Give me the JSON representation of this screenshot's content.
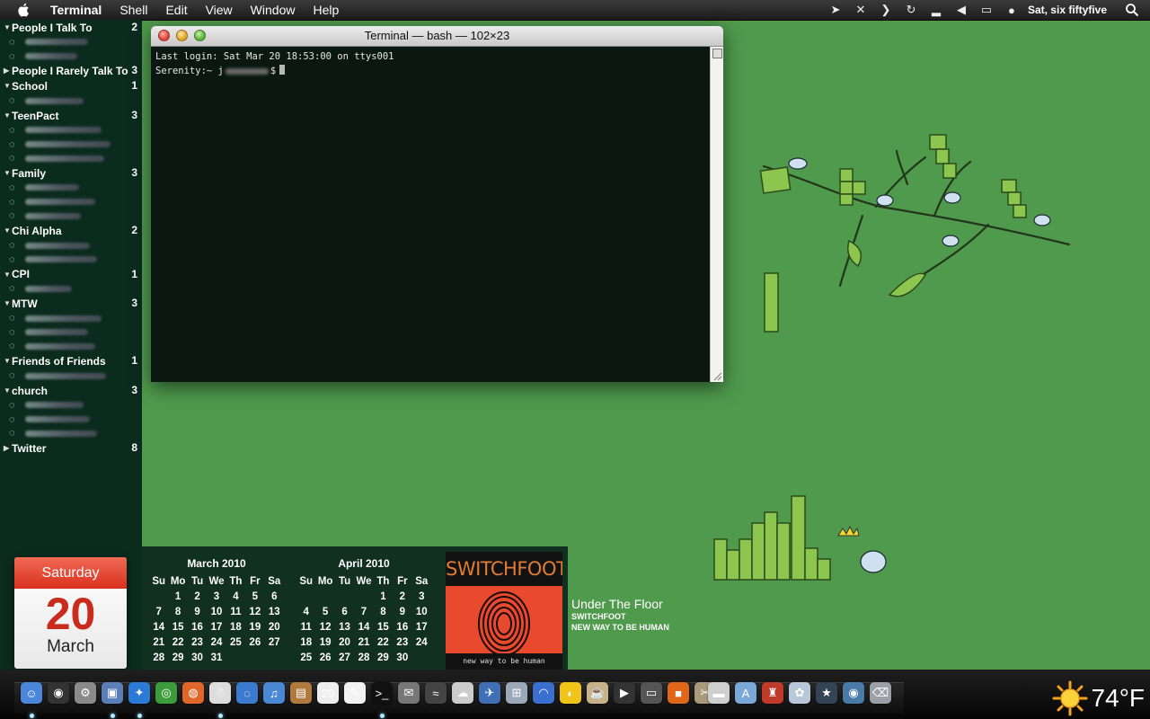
{
  "menubar": {
    "apple_icon": "apple-logo-icon",
    "items": [
      "Terminal",
      "Shell",
      "Edit",
      "View",
      "Window",
      "Help"
    ],
    "extras": [
      "cursor-icon",
      "network-status-icon",
      "forward-icon",
      "sync-icon",
      "wifi-bars-icon",
      "volume-icon",
      "battery-icon",
      "user-icon"
    ],
    "clock": "Sat, six fiftyfive",
    "search_icon": "spotlight-search-icon"
  },
  "buddy_list": {
    "groups": [
      {
        "name": "People I Talk To",
        "count": "2",
        "expanded": true,
        "buddies": 2
      },
      {
        "name": "People I Rarely Talk To",
        "count": "3",
        "expanded": false,
        "buddies": 0
      },
      {
        "name": "School",
        "count": "1",
        "expanded": true,
        "buddies": 1
      },
      {
        "name": "TeenPact",
        "count": "3",
        "expanded": true,
        "buddies": 3
      },
      {
        "name": "Family",
        "count": "3",
        "expanded": true,
        "buddies": 3
      },
      {
        "name": "Chi Alpha",
        "count": "2",
        "expanded": true,
        "buddies": 2
      },
      {
        "name": "CPI",
        "count": "1",
        "expanded": true,
        "buddies": 1
      },
      {
        "name": "MTW",
        "count": "3",
        "expanded": true,
        "buddies": 3
      },
      {
        "name": "Friends of Friends",
        "count": "1",
        "expanded": true,
        "buddies": 1
      },
      {
        "name": "church",
        "count": "3",
        "expanded": true,
        "buddies": 3
      },
      {
        "name": "Twitter",
        "count": "8",
        "expanded": false,
        "buddies": 0
      }
    ]
  },
  "terminal": {
    "title": "Terminal — bash — 102×23",
    "line1": "Last login: Sat Mar 20 18:53:00 on ttys001",
    "prompt_prefix": "Serenity:~ j",
    "prompt_suffix": "$"
  },
  "ical": {
    "weekday": "Saturday",
    "day": "20",
    "month": "March"
  },
  "calendar": {
    "weekdays": [
      "Su",
      "Mo",
      "Tu",
      "We",
      "Th",
      "Fr",
      "Sa"
    ],
    "months": [
      {
        "title": "March 2010",
        "weeks": [
          [
            "",
            "1",
            "2",
            "3",
            "4",
            "5",
            "6"
          ],
          [
            "7",
            "8",
            "9",
            "10",
            "11",
            "12",
            "13"
          ],
          [
            "14",
            "15",
            "16",
            "17",
            "18",
            "19",
            "20"
          ],
          [
            "21",
            "22",
            "23",
            "24",
            "25",
            "26",
            "27"
          ],
          [
            "28",
            "29",
            "30",
            "31",
            "",
            "",
            ""
          ]
        ]
      },
      {
        "title": "April 2010",
        "weeks": [
          [
            "",
            "",
            "",
            "",
            "1",
            "2",
            "3"
          ],
          [
            "4",
            "5",
            "6",
            "7",
            "8",
            "9",
            "10"
          ],
          [
            "11",
            "12",
            "13",
            "14",
            "15",
            "16",
            "17"
          ],
          [
            "18",
            "19",
            "20",
            "21",
            "22",
            "23",
            "24"
          ],
          [
            "25",
            "26",
            "27",
            "28",
            "29",
            "30",
            ""
          ]
        ]
      }
    ]
  },
  "now_playing": {
    "band_logo": "SWITCHFOOT",
    "cover_caption": "new way to be human",
    "title": "Under The Floor",
    "artist": "SWITCHFOOT",
    "album": "NEW WAY TO BE HUMAN"
  },
  "dock": {
    "icons": [
      {
        "name": "finder-icon",
        "color": "#4a86d9",
        "glyph": "☺",
        "running": true
      },
      {
        "name": "dashboard-icon",
        "color": "#333333",
        "glyph": "◉",
        "running": false
      },
      {
        "name": "system-preferences-icon",
        "color": "#8a8a8a",
        "glyph": "⚙",
        "running": false
      },
      {
        "name": "preview-icon",
        "color": "#5a7fb8",
        "glyph": "▣",
        "running": true
      },
      {
        "name": "safari-icon",
        "color": "#2b7bd6",
        "glyph": "✦",
        "running": true
      },
      {
        "name": "chrome-icon",
        "color": "#3c9c3c",
        "glyph": "◎",
        "running": false
      },
      {
        "name": "firefox-icon",
        "color": "#e0672a",
        "glyph": "◍",
        "running": false
      },
      {
        "name": "snowman-icon",
        "color": "#dddddd",
        "glyph": "☃",
        "running": true
      },
      {
        "name": "ichat-icon",
        "color": "#3a7bd0",
        "glyph": "◌",
        "running": false
      },
      {
        "name": "itunes-icon",
        "color": "#4b88d4",
        "glyph": "♫",
        "running": false
      },
      {
        "name": "iphoto-icon",
        "color": "#b07a3d",
        "glyph": "▤",
        "running": false
      },
      {
        "name": "ical-icon",
        "color": "#eeeeee",
        "glyph": "20",
        "running": false
      },
      {
        "name": "textedit-icon",
        "color": "#f2f2f2",
        "glyph": "✎",
        "running": false
      },
      {
        "name": "terminal-icon",
        "color": "#111111",
        "glyph": ">_",
        "running": true
      },
      {
        "name": "script-editor-icon",
        "color": "#777777",
        "glyph": "✉",
        "running": false
      },
      {
        "name": "activity-monitor-icon",
        "color": "#444444",
        "glyph": "≈",
        "running": false
      },
      {
        "name": "weather-app-icon",
        "color": "#cccccc",
        "glyph": "☁",
        "running": false
      },
      {
        "name": "mail-icon",
        "color": "#3f6fb5",
        "glyph": "✈",
        "running": false
      },
      {
        "name": "network-utility-icon",
        "color": "#9aa8b8",
        "glyph": "⊞",
        "running": false
      },
      {
        "name": "airport-icon",
        "color": "#3a6fd0",
        "glyph": "◠",
        "running": false
      },
      {
        "name": "cyberduck-icon",
        "color": "#f0c419",
        "glyph": "◐",
        "running": false
      },
      {
        "name": "coffee-icon",
        "color": "#c8b28a",
        "glyph": "☕",
        "running": false
      },
      {
        "name": "plex-icon",
        "color": "#333333",
        "glyph": "▶",
        "running": false
      },
      {
        "name": "photo-booth-icon",
        "color": "#555555",
        "glyph": "▭",
        "running": false
      },
      {
        "name": "vlc-icon",
        "color": "#e0671a",
        "glyph": "■",
        "running": false
      },
      {
        "name": "gimp-icon",
        "color": "#a89a7a",
        "glyph": "✂",
        "running": false
      },
      {
        "name": "disk-icon",
        "color": "#cfcfcf",
        "glyph": "▬",
        "running": false
      },
      {
        "name": "applications-folder-icon",
        "color": "#7aa9d9",
        "glyph": "A",
        "running": false
      },
      {
        "name": "mario-icon",
        "color": "#c03a2a",
        "glyph": "♜",
        "running": false
      },
      {
        "name": "documents-icon",
        "color": "#b8c8d8",
        "glyph": "✿",
        "running": false
      },
      {
        "name": "downloads-icon",
        "color": "#334455",
        "glyph": "★",
        "running": false
      },
      {
        "name": "dvd-player-icon",
        "color": "#4a7aa8",
        "glyph": "◉",
        "running": false
      },
      {
        "name": "trash-icon",
        "color": "#9aa0a6",
        "glyph": "⌫",
        "running": false
      }
    ]
  },
  "weather": {
    "icon": "sun-icon",
    "temperature": "74°F"
  }
}
